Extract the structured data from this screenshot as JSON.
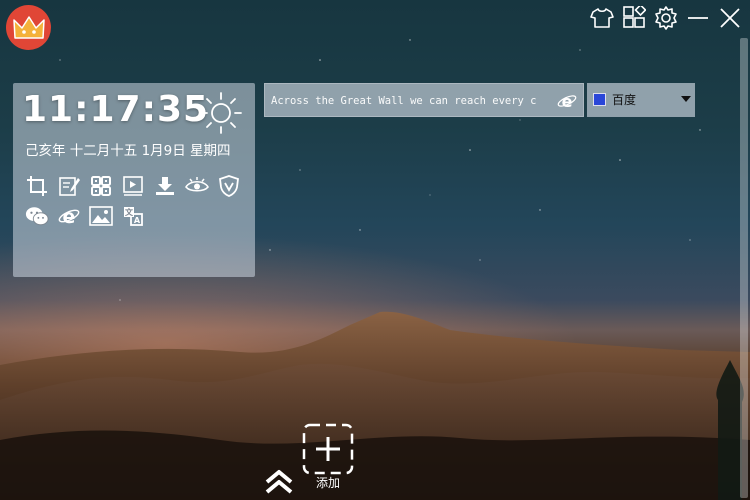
{
  "clock": {
    "time": "11:17:35",
    "date": "己亥年 十二月十五 1月9日 星期四",
    "weather_icon": "sun-icon"
  },
  "tools": [
    {
      "name": "crop-icon"
    },
    {
      "name": "notepad-icon"
    },
    {
      "name": "qr-code-icon"
    },
    {
      "name": "slideshow-icon"
    },
    {
      "name": "download-icon"
    },
    {
      "name": "eye-icon"
    },
    {
      "name": "shield-icon"
    },
    {
      "name": "wechat-icon"
    },
    {
      "name": "ie-browser-icon"
    },
    {
      "name": "picture-icon"
    },
    {
      "name": "translate-icon"
    }
  ],
  "search": {
    "placeholder": "Across the Great Wall we can reach every c",
    "engine": "百度"
  },
  "top_controls": [
    "skin-icon",
    "apps-grid-icon",
    "settings-icon",
    "minimize-icon",
    "close-icon"
  ],
  "bottom": {
    "add_label": "添加"
  },
  "colors": {
    "logo_bg": "#e04636",
    "crown": "#f4b23a",
    "engine_icon": "#2a46d8"
  }
}
